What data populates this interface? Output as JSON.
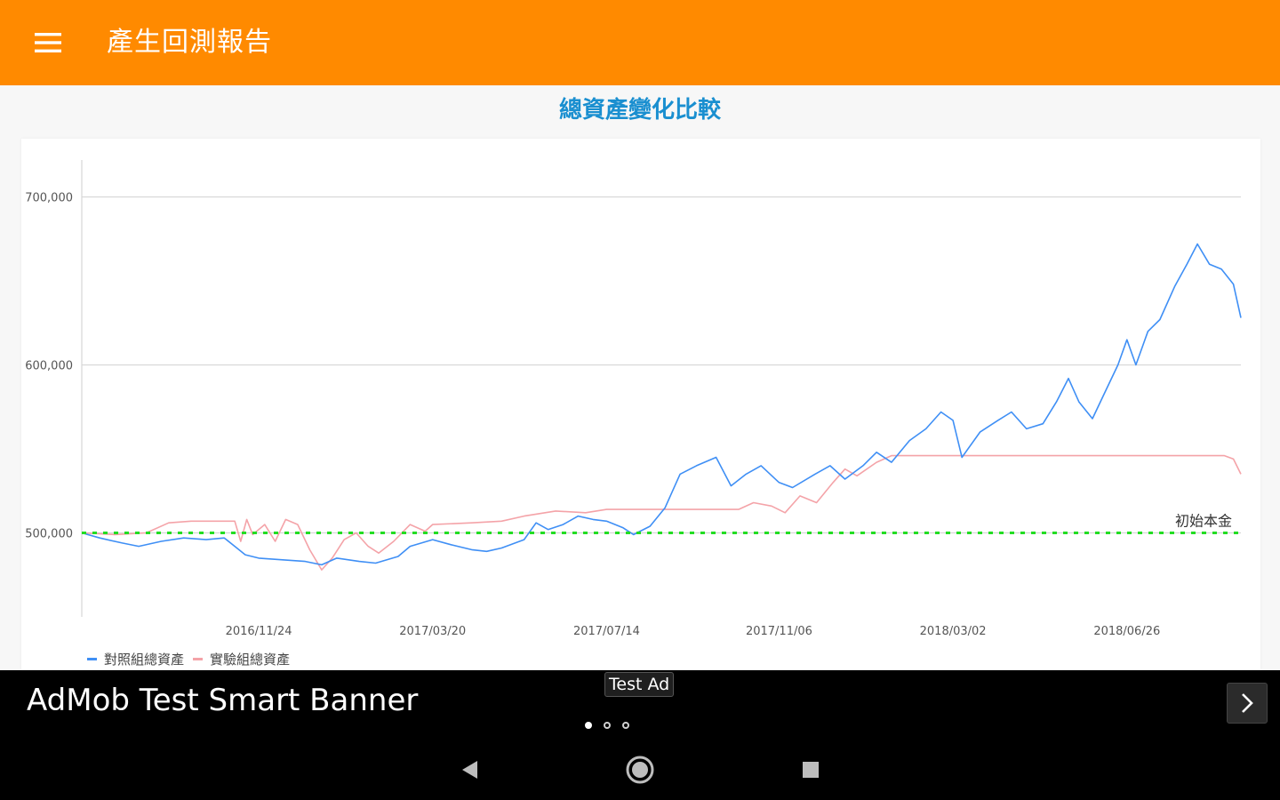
{
  "app": {
    "title": "產生回測報告",
    "menu_icon": "hamburger-menu-icon",
    "colors": {
      "appbar": "#ff8a00",
      "heading": "#1a8fd0"
    }
  },
  "chart_heading": "總資產變化比較",
  "chart_data": {
    "type": "line",
    "title": "總資產變化比較",
    "x_tick_labels": [
      "2016/11/24",
      "2017/03/20",
      "2017/07/14",
      "2017/11/06",
      "2018/03/02",
      "2018/06/26"
    ],
    "x_range": [
      "2016/07/29",
      "2018/09/10"
    ],
    "y_tick_labels": [
      "500,000",
      "600,000",
      "700,000"
    ],
    "ylim": [
      450000,
      722000
    ],
    "grid": "horizontal",
    "legend_position": "bottom-left",
    "reference_line": {
      "label": "初始本金",
      "value": 500000,
      "color": "#22dd22",
      "style": "dashed"
    },
    "series": [
      {
        "name": "對照組總資產",
        "color": "#3f8ff5",
        "points": [
          [
            "2016/07/29",
            500000
          ],
          [
            "2016/08/10",
            497000
          ],
          [
            "2016/08/25",
            494000
          ],
          [
            "2016/09/05",
            492000
          ],
          [
            "2016/09/20",
            495000
          ],
          [
            "2016/10/05",
            497000
          ],
          [
            "2016/10/20",
            496000
          ],
          [
            "2016/11/01",
            497000
          ],
          [
            "2016/11/08",
            492000
          ],
          [
            "2016/11/15",
            487000
          ],
          [
            "2016/11/24",
            485000
          ],
          [
            "2016/12/10",
            484000
          ],
          [
            "2016/12/25",
            483000
          ],
          [
            "2017/01/05",
            481000
          ],
          [
            "2017/01/15",
            485000
          ],
          [
            "2017/01/30",
            483000
          ],
          [
            "2017/02/10",
            482000
          ],
          [
            "2017/02/25",
            486000
          ],
          [
            "2017/03/05",
            492000
          ],
          [
            "2017/03/20",
            496000
          ],
          [
            "2017/04/01",
            493000
          ],
          [
            "2017/04/15",
            490000
          ],
          [
            "2017/04/25",
            489000
          ],
          [
            "2017/05/05",
            491000
          ],
          [
            "2017/05/20",
            496000
          ],
          [
            "2017/05/28",
            506000
          ],
          [
            "2017/06/05",
            502000
          ],
          [
            "2017/06/15",
            505000
          ],
          [
            "2017/06/25",
            510000
          ],
          [
            "2017/07/05",
            508000
          ],
          [
            "2017/07/14",
            507000
          ],
          [
            "2017/07/25",
            503000
          ],
          [
            "2017/08/01",
            499000
          ],
          [
            "2017/08/12",
            504000
          ],
          [
            "2017/08/22",
            515000
          ],
          [
            "2017/09/01",
            535000
          ],
          [
            "2017/09/12",
            540000
          ],
          [
            "2017/09/25",
            545000
          ],
          [
            "2017/10/05",
            528000
          ],
          [
            "2017/10/15",
            535000
          ],
          [
            "2017/10/25",
            540000
          ],
          [
            "2017/11/06",
            530000
          ],
          [
            "2017/11/15",
            527000
          ],
          [
            "2017/11/30",
            535000
          ],
          [
            "2017/12/10",
            540000
          ],
          [
            "2017/12/20",
            532000
          ],
          [
            "2018/01/01",
            540000
          ],
          [
            "2018/01/10",
            548000
          ],
          [
            "2018/01/20",
            542000
          ],
          [
            "2018/02/01",
            555000
          ],
          [
            "2018/02/12",
            562000
          ],
          [
            "2018/02/22",
            572000
          ],
          [
            "2018/03/02",
            567000
          ],
          [
            "2018/03/08",
            545000
          ],
          [
            "2018/03/20",
            560000
          ],
          [
            "2018/04/01",
            567000
          ],
          [
            "2018/04/10",
            572000
          ],
          [
            "2018/04/20",
            562000
          ],
          [
            "2018/05/01",
            565000
          ],
          [
            "2018/05/10",
            578000
          ],
          [
            "2018/05/18",
            592000
          ],
          [
            "2018/05/25",
            578000
          ],
          [
            "2018/06/03",
            568000
          ],
          [
            "2018/06/12",
            585000
          ],
          [
            "2018/06/20",
            600000
          ],
          [
            "2018/06/26",
            615000
          ],
          [
            "2018/07/02",
            600000
          ],
          [
            "2018/07/10",
            620000
          ],
          [
            "2018/07/18",
            627000
          ],
          [
            "2018/07/28",
            647000
          ],
          [
            "2018/08/05",
            660000
          ],
          [
            "2018/08/12",
            672000
          ],
          [
            "2018/08/20",
            660000
          ],
          [
            "2018/08/28",
            657000
          ],
          [
            "2018/09/05",
            648000
          ],
          [
            "2018/09/10",
            628000
          ]
        ]
      },
      {
        "name": "實驗組總資產",
        "color": "#f4a3a8",
        "points": [
          [
            "2016/07/29",
            500000
          ],
          [
            "2016/08/20",
            499000
          ],
          [
            "2016/09/10",
            500000
          ],
          [
            "2016/09/25",
            506000
          ],
          [
            "2016/10/10",
            507000
          ],
          [
            "2016/10/25",
            507000
          ],
          [
            "2016/11/08",
            507000
          ],
          [
            "2016/11/12",
            495000
          ],
          [
            "2016/11/16",
            508000
          ],
          [
            "2016/11/20",
            499000
          ],
          [
            "2016/11/28",
            505000
          ],
          [
            "2016/12/05",
            495000
          ],
          [
            "2016/12/12",
            508000
          ],
          [
            "2016/12/20",
            505000
          ],
          [
            "2016/12/28",
            490000
          ],
          [
            "2017/01/05",
            478000
          ],
          [
            "2017/01/12",
            485000
          ],
          [
            "2017/01/20",
            496000
          ],
          [
            "2017/01/28",
            500000
          ],
          [
            "2017/02/05",
            492000
          ],
          [
            "2017/02/12",
            488000
          ],
          [
            "2017/02/22",
            495000
          ],
          [
            "2017/03/05",
            505000
          ],
          [
            "2017/03/15",
            501000
          ],
          [
            "2017/03/20",
            505000
          ],
          [
            "2017/04/15",
            506000
          ],
          [
            "2017/05/05",
            507000
          ],
          [
            "2017/05/20",
            510000
          ],
          [
            "2017/06/10",
            513000
          ],
          [
            "2017/06/30",
            512000
          ],
          [
            "2017/07/14",
            514000
          ],
          [
            "2017/08/15",
            514000
          ],
          [
            "2017/09/15",
            514000
          ],
          [
            "2017/10/10",
            514000
          ],
          [
            "2017/10/20",
            518000
          ],
          [
            "2017/11/01",
            516000
          ],
          [
            "2017/11/10",
            512000
          ],
          [
            "2017/11/20",
            522000
          ],
          [
            "2017/12/01",
            518000
          ],
          [
            "2017/12/12",
            530000
          ],
          [
            "2017/12/20",
            538000
          ],
          [
            "2017/12/28",
            534000
          ],
          [
            "2018/01/10",
            542000
          ],
          [
            "2018/01/20",
            546000
          ],
          [
            "2018/03/02",
            546000
          ],
          [
            "2018/05/01",
            546000
          ],
          [
            "2018/06/26",
            546000
          ],
          [
            "2018/08/30",
            546000
          ],
          [
            "2018/09/05",
            544000
          ],
          [
            "2018/09/10",
            535000
          ]
        ]
      }
    ]
  },
  "ad": {
    "title": "AdMob Test Smart Banner",
    "badge": "Test Ad",
    "next_icon": "chevron-right-icon",
    "dots_total": 3,
    "dots_active": 1
  },
  "nav": {
    "back_icon": "back-triangle-icon",
    "home_icon": "home-circle-icon",
    "recents_icon": "recents-square-icon"
  }
}
